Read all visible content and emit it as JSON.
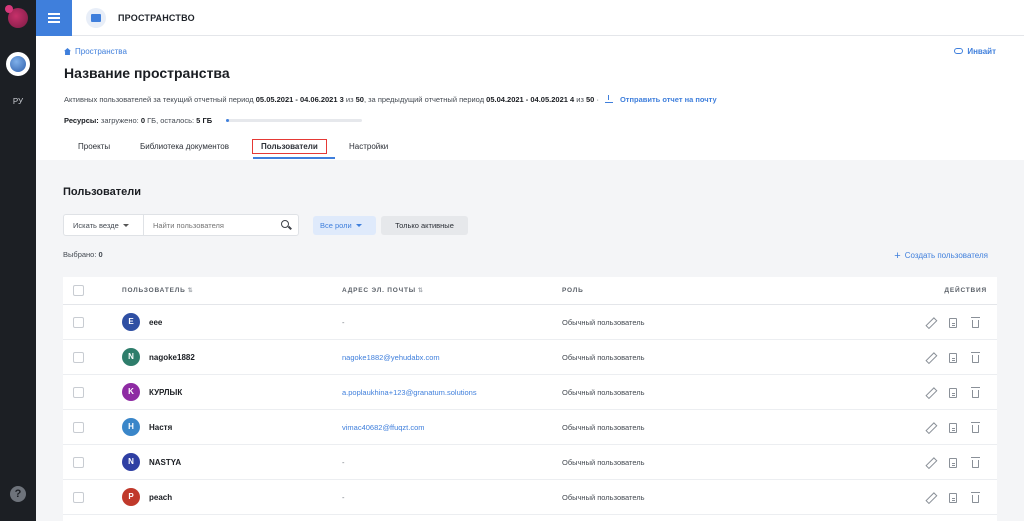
{
  "rail": {
    "lang": "РУ",
    "help": "?"
  },
  "topbar": {
    "title": "ПРОСТРАНСТВО"
  },
  "header": {
    "breadcrumb": "Пространства",
    "invite": "Инвайт",
    "title": "Название пространства",
    "period": {
      "prefix": "Активных пользователей за текущий отчетный период",
      "current_range": "05.05.2021 - 04.06.2021",
      "current_count": "3",
      "of": "из",
      "current_total": "50",
      "mid": ", за предыдущий отчетный период",
      "prev_range": "05.04.2021 - 04.05.2021",
      "prev_count": "4",
      "prev_total": "50",
      "send_report": "Отправить отчет на почту"
    },
    "resources": {
      "label": "Ресурсы:",
      "loaded_label": "загружено:",
      "loaded_value": "0",
      "unit": "ГБ",
      "left_label": ", осталось:",
      "left_value": "5",
      "usage_fraction": 0.0
    },
    "tabs": [
      {
        "label": "Проекты"
      },
      {
        "label": "Библиотека документов"
      },
      {
        "label": "Пользователи",
        "active": true
      },
      {
        "label": "Настройки"
      }
    ]
  },
  "users": {
    "title": "Пользователи",
    "search_scope": "Искать везде",
    "search_placeholder": "Найти пользователя",
    "roles_filter": "Все роли",
    "active_only": "Только активные",
    "selected_label": "Выбрано:",
    "selected_count": "0",
    "create_user": "Создать пользователя",
    "columns": {
      "user": "ПОЛЬЗОВАТЕЛЬ",
      "email": "АДРЕС ЭЛ. ПОЧТЫ",
      "role": "РОЛЬ",
      "actions": "ДЕЙСТВИЯ"
    },
    "rows": [
      {
        "initial": "E",
        "name": "eee",
        "email": "-",
        "role": "Обычный пользователь",
        "color": "#2f4fa3"
      },
      {
        "initial": "N",
        "name": "nagoke1882",
        "email": "nagoke1882@yehudabx.com",
        "role": "Обычный пользователь",
        "color": "#2e7d6b"
      },
      {
        "initial": "K",
        "name": "КУРЛЫК",
        "email": "a.poplaukhina+123@granatum.solutions",
        "role": "Обычный пользователь",
        "color": "#8e2ba3"
      },
      {
        "initial": "H",
        "name": "Настя",
        "email": "vimac40682@ffuqzt.com",
        "role": "Обычный пользователь",
        "color": "#3a86c9"
      },
      {
        "initial": "N",
        "name": "NASTYA",
        "email": "-",
        "role": "Обычный пользователь",
        "color": "#2f3fa3"
      },
      {
        "initial": "P",
        "name": "peach",
        "email": "-",
        "role": "Обычный пользователь",
        "color": "#c0392b"
      }
    ]
  }
}
